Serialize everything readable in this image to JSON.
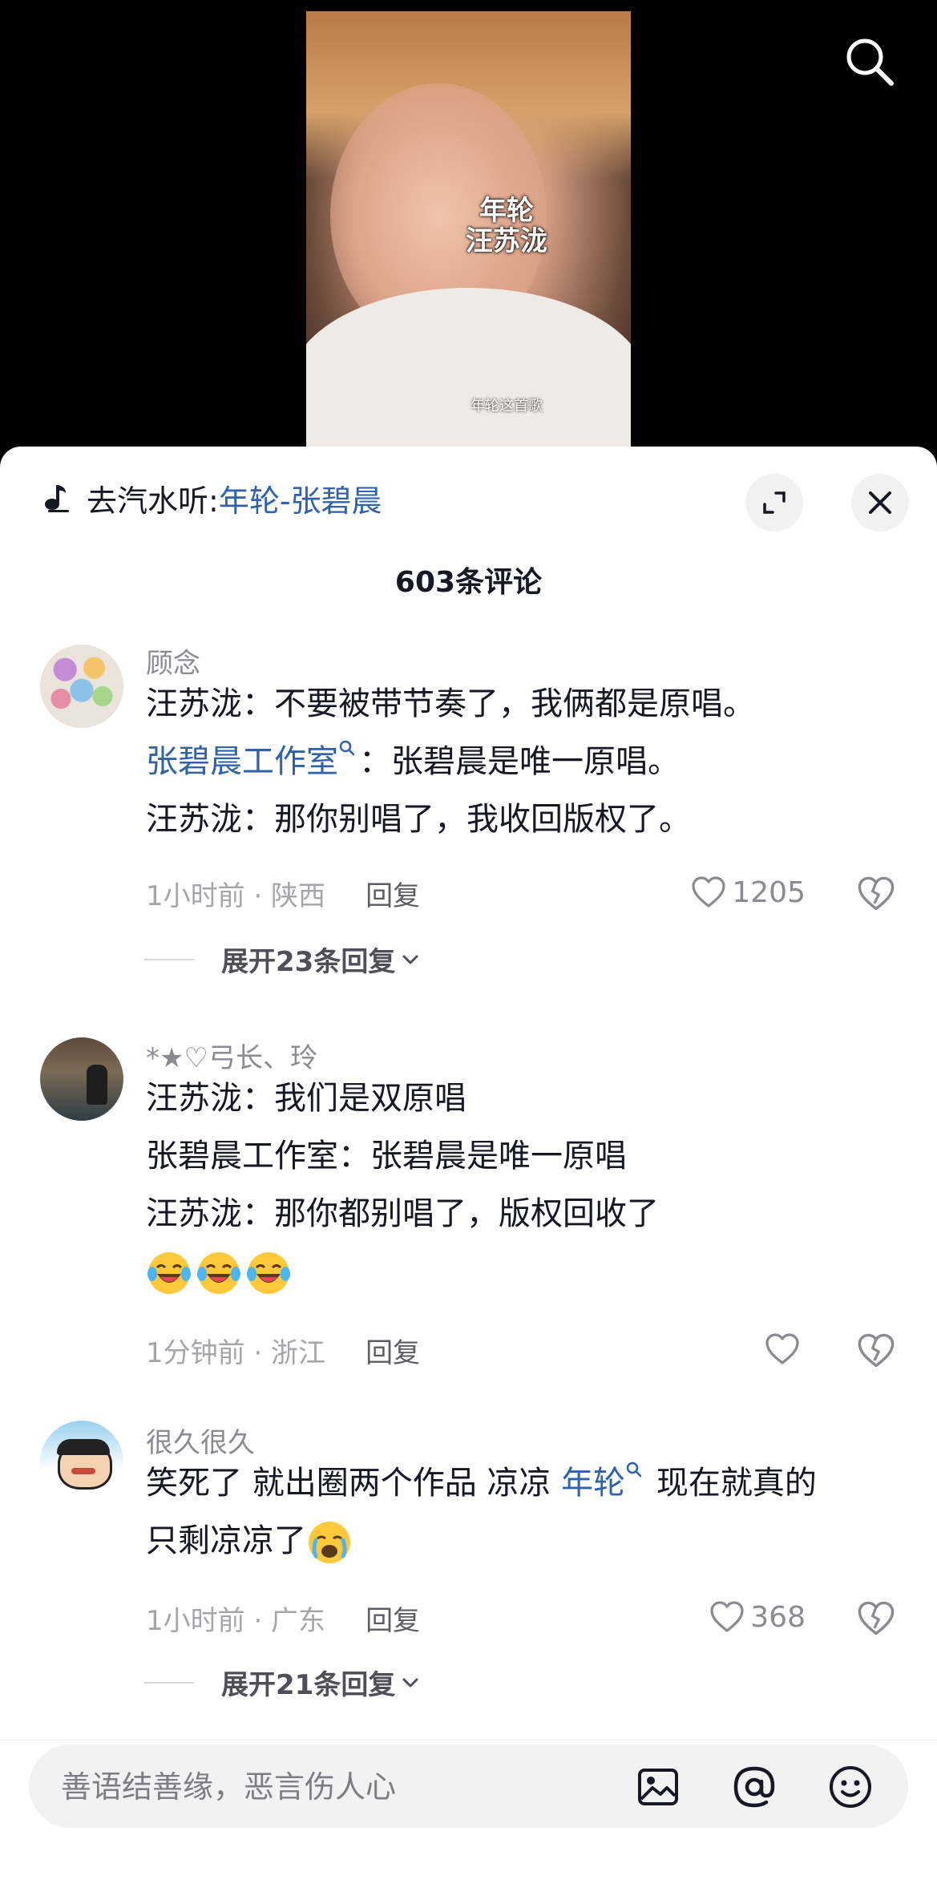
{
  "video": {
    "overlay_title_line1": "年轮",
    "overlay_title_line2": "汪苏泷",
    "caption": "年轮这首歌"
  },
  "sheet": {
    "music_prefix": "去汽水听:",
    "music_link": "年轮-张碧晨",
    "comment_count": "603条评论"
  },
  "comments": [
    {
      "user": "顾念",
      "lines": [
        "汪苏泷：不要被带节奏了，我俩都是原唱。",
        "张碧晨工作室",
        "：张碧晨是唯一原唱。",
        "汪苏泷：那你别唱了，我收回版权了。"
      ],
      "time": "1小时前 · 陕西",
      "reply": "回复",
      "likes": "1205",
      "expand": "展开23条回复"
    },
    {
      "user": "*★♡弓长、玲",
      "lines": [
        "汪苏泷：我们是双原唱",
        "张碧晨工作室：张碧晨是唯一原唱",
        "汪苏泷：那你都别唱了，版权回收了"
      ],
      "emoji_count": 3,
      "time": "1分钟前 · 浙江",
      "reply": "回复",
      "likes": ""
    },
    {
      "user": "很久很久",
      "line1_a": "笑死了 就出圈两个作品 凉凉 ",
      "line1_mention": "年轮",
      "line1_b": " 现在就真的",
      "line2": "只剩凉凉了",
      "time": "1小时前 · 广东",
      "reply": "回复",
      "likes": "368",
      "expand": "展开21条回复"
    }
  ],
  "input": {
    "placeholder": "善语结善缘，恶言伤人心"
  },
  "icons": {
    "search": "search-icon",
    "music": "music-note-icon",
    "expand": "expand-icon",
    "close": "close-icon",
    "like": "heart-icon",
    "dislike": "broken-heart-icon",
    "image": "image-icon",
    "mention": "at-icon",
    "emoji": "emoji-icon"
  },
  "colors": {
    "link": "#2f62a8",
    "text": "#161823",
    "secondary": "#8a8b91"
  }
}
